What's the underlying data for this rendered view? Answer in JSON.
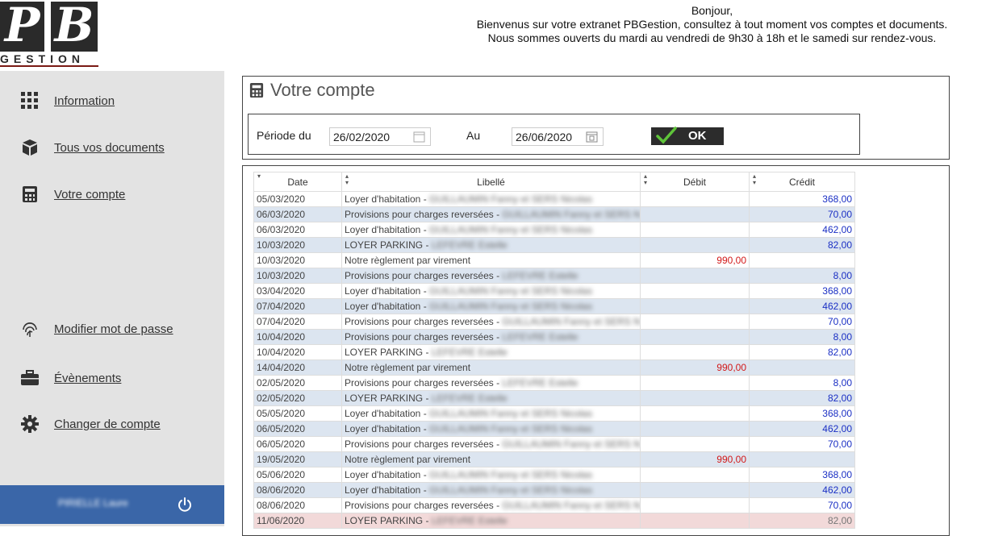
{
  "brand": {
    "logo_p": "P",
    "logo_b": "B",
    "logo_word": "GESTION"
  },
  "welcome": {
    "line1": "Bonjour,",
    "line2": "Bienvenus sur votre extranet PBGestion, consultez à tout moment vos comptes et documents.",
    "line3": "Nous sommes ouverts du mardi au vendredi de 9h30 à 18h et le samedi sur rendez-vous."
  },
  "sidebar": {
    "items": [
      {
        "label": "Information",
        "icon": "grid-icon"
      },
      {
        "label": "Tous vos documents",
        "icon": "cube-icon"
      },
      {
        "label": "Votre compte",
        "icon": "calculator-icon"
      },
      {
        "label": "Modifier mot de passe",
        "icon": "fingerprint-icon"
      },
      {
        "label": "Évènements",
        "icon": "briefcase-icon"
      },
      {
        "label": "Changer de compte",
        "icon": "gear-icon"
      }
    ],
    "user_name": "PIRIELLE Laure"
  },
  "account": {
    "title": "Votre compte",
    "period_from_label": "Période du",
    "period_from_value": "26/02/2020",
    "period_to_label": "Au",
    "period_to_value": "26/06/2020",
    "ok_label": "OK"
  },
  "ledger": {
    "headers": [
      "Date",
      "Libellé",
      "Débit",
      "Crédit"
    ],
    "rows": [
      {
        "date": "05/03/2020",
        "label": "Loyer d'habitation - ",
        "hidden": "GUILLAUMIN Fanny et SERS Nicolas",
        "debit": "",
        "credit": "368,00"
      },
      {
        "date": "06/03/2020",
        "label": "Provisions pour charges reversées - ",
        "hidden": "GUILLAUMIN Fanny et SERS N",
        "debit": "",
        "credit": "70,00"
      },
      {
        "date": "06/03/2020",
        "label": "Loyer d'habitation - ",
        "hidden": "GUILLAUMIN Fanny et SERS Nicolas",
        "debit": "",
        "credit": "462,00"
      },
      {
        "date": "10/03/2020",
        "label": "LOYER PARKING - ",
        "hidden": "LEFEVRE Estelle",
        "debit": "",
        "credit": "82,00"
      },
      {
        "date": "10/03/2020",
        "label": "Notre règlement par virement",
        "hidden": "",
        "debit": "990,00",
        "credit": ""
      },
      {
        "date": "10/03/2020",
        "label": "Provisions pour charges reversées - ",
        "hidden": "LEFEVRE Estelle",
        "debit": "",
        "credit": "8,00"
      },
      {
        "date": "03/04/2020",
        "label": "Loyer d'habitation - ",
        "hidden": "GUILLAUMIN Fanny et SERS Nicolas",
        "debit": "",
        "credit": "368,00"
      },
      {
        "date": "07/04/2020",
        "label": "Loyer d'habitation - ",
        "hidden": "GUILLAUMIN Fanny et SERS Nicolas",
        "debit": "",
        "credit": "462,00"
      },
      {
        "date": "07/04/2020",
        "label": "Provisions pour charges reversées - ",
        "hidden": "GUILLAUMIN Fanny et SERS N",
        "debit": "",
        "credit": "70,00"
      },
      {
        "date": "10/04/2020",
        "label": "Provisions pour charges reversées - ",
        "hidden": "LEFEVRE Estelle",
        "debit": "",
        "credit": "8,00"
      },
      {
        "date": "10/04/2020",
        "label": "LOYER PARKING - ",
        "hidden": "LEFEVRE Estelle",
        "debit": "",
        "credit": "82,00"
      },
      {
        "date": "14/04/2020",
        "label": "Notre règlement par virement",
        "hidden": "",
        "debit": "990,00",
        "credit": ""
      },
      {
        "date": "02/05/2020",
        "label": "Provisions pour charges reversées - ",
        "hidden": "LEFEVRE Estelle",
        "debit": "",
        "credit": "8,00"
      },
      {
        "date": "02/05/2020",
        "label": "LOYER PARKING - ",
        "hidden": "LEFEVRE Estelle",
        "debit": "",
        "credit": "82,00"
      },
      {
        "date": "05/05/2020",
        "label": "Loyer d'habitation - ",
        "hidden": "GUILLAUMIN Fanny et SERS Nicolas",
        "debit": "",
        "credit": "368,00"
      },
      {
        "date": "06/05/2020",
        "label": "Loyer d'habitation - ",
        "hidden": "GUILLAUMIN Fanny et SERS Nicolas",
        "debit": "",
        "credit": "462,00"
      },
      {
        "date": "06/05/2020",
        "label": "Provisions pour charges reversées - ",
        "hidden": "GUILLAUMIN Fanny et SERS N",
        "debit": "",
        "credit": "70,00"
      },
      {
        "date": "19/05/2020",
        "label": "Notre règlement par virement",
        "hidden": "",
        "debit": "990,00",
        "credit": ""
      },
      {
        "date": "05/06/2020",
        "label": "Loyer d'habitation - ",
        "hidden": "GUILLAUMIN Fanny et SERS Nicolas",
        "debit": "",
        "credit": "368,00"
      },
      {
        "date": "08/06/2020",
        "label": "Loyer d'habitation - ",
        "hidden": "GUILLAUMIN Fanny et SERS Nicolas",
        "debit": "",
        "credit": "462,00"
      },
      {
        "date": "08/06/2020",
        "label": "Provisions pour charges reversées - ",
        "hidden": "GUILLAUMIN Fanny et SERS N",
        "debit": "",
        "credit": "70,00"
      },
      {
        "date": "11/06/2020",
        "label": "LOYER PARKING - ",
        "hidden": "LEFEVRE Estelle",
        "debit": "",
        "credit": "82,00"
      }
    ]
  },
  "colors": {
    "user_bar": "#3a66a8",
    "debit": "#d21818",
    "credit": "#1a2fc4",
    "row_alt": "#dce5f0",
    "row_highlight": "#f2d9d9"
  }
}
